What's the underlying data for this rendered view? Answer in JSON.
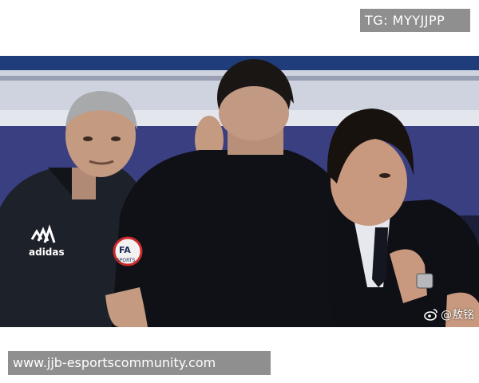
{
  "badge": {
    "text": "TG: MYYJJPP"
  },
  "photo": {
    "watermark": "@敖铭",
    "watermark_icon": "weibo-icon",
    "adidas_text": "adidas",
    "fa_badge_text": "FA",
    "sports_text": "SPORTS"
  },
  "footer": {
    "url_text": "www.jjb-esportscommunity.com"
  }
}
